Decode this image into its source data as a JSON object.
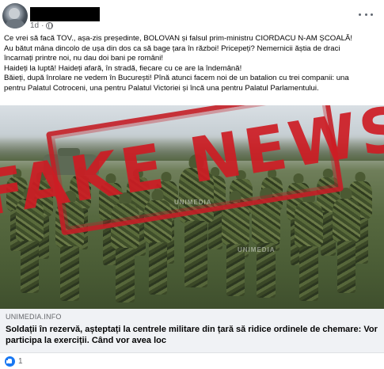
{
  "post": {
    "author_name": "",
    "time": "1d",
    "visibility_icon": "globe-icon",
    "more_icon": "more-options-icon",
    "text_lines": [
      "Ce  vrei să facă TOV., așa-zis președinte, BOLOVAN și falsul prim-ministru CIORDACU N-AM ȘCOALĂ!",
      "Au bătut mâna dincolo de ușa din dos ca să bage țara în război! Pricepeți? Nemernicii ăștia de draci",
      "încarnați printre noi, nu dau doi bani pe români!",
      "Haideți la luptă! Haideți afară, în stradă, fiecare cu ce are la îndemână!",
      "Băieți, după înrolare ne vedem în București! Pînă atunci facem noi de un batalion cu trei companii: una",
      "pentru Palatul Cotroceni, una pentru Palatul Victoriei și încă una pentru Palatul Parlamentului."
    ]
  },
  "image": {
    "stamp_text": "FAKE NEWS",
    "stamp_color": "#cd1c24",
    "watermark": "UNIMEDIA"
  },
  "link_preview": {
    "domain": "UNIMEDIA.INFO",
    "title": "Soldații în rezervă, așteptați la centrele militare din țară să ridice ordinele de chemare: Vor participa la exerciții. Când vor avea loc"
  },
  "reactions": {
    "icon": "like-icon",
    "count": "1"
  }
}
